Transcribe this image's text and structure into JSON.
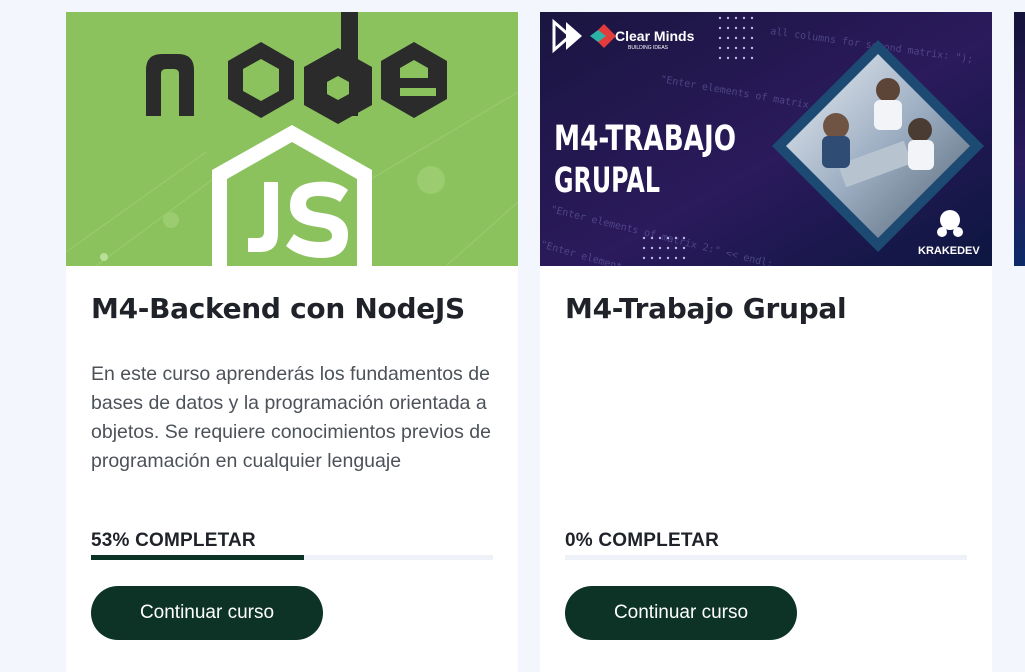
{
  "courses": [
    {
      "thumbnail_icon": "nodejs-logo",
      "thumbnail_colors": {
        "background": "#8cc25e",
        "logo_dark": "#2b2b2b",
        "logo_light": "#ffffff"
      },
      "title": "M4-Backend con NodeJS",
      "description": "En este curso aprenderás los fundamentos de bases de datos y la programación orientada a objetos. Se requiere conocimientos previos de programación en cualquier lenguaje",
      "progress_percent": 53,
      "progress_label": "53% COMPLETAR",
      "button_label": "Continuar curso"
    },
    {
      "thumbnail_icon": "clear-minds-banner",
      "thumbnail_brand": "Clear Minds",
      "thumbnail_brand_tagline": "BUILDING IDEAS",
      "thumbnail_heading_line1": "M4-TRABAJO",
      "thumbnail_heading_line2": "GRUPAL",
      "thumbnail_footer_brand": "KRAKEDEV",
      "thumbnail_colors": {
        "background": "#1a1540",
        "accent": "#e23c3c"
      },
      "title": "M4-Trabajo Grupal",
      "description": "",
      "progress_percent": 0,
      "progress_label": "0% COMPLETAR",
      "button_label": "Continuar curso"
    }
  ],
  "colors": {
    "page_bg": "#f3f6fd",
    "primary": "#0c3325"
  }
}
